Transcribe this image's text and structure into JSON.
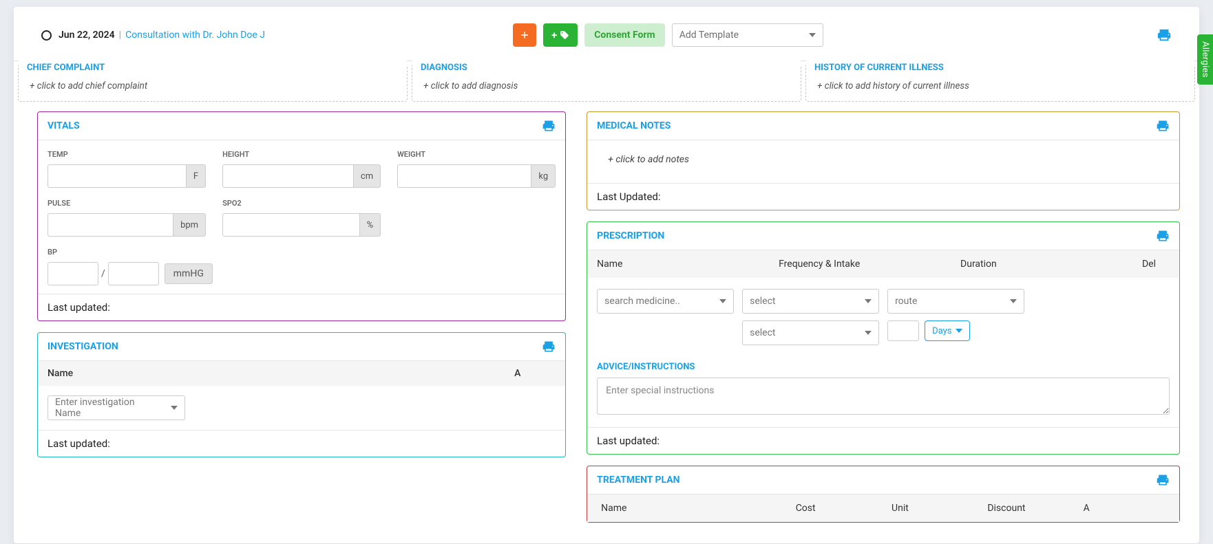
{
  "header": {
    "date": "Jun 22, 2024",
    "consultation_label": "Consultation with Dr. John Doe J",
    "consent_label": "Consent Form",
    "template_placeholder": "Add Template",
    "allergies_tab": "Allergies"
  },
  "complaint_boxes": {
    "chief_complaint": {
      "title": "CHIEF COMPLAINT",
      "hint": "+ click to add chief complaint"
    },
    "diagnosis": {
      "title": "DIAGNOSIS",
      "hint": "+ click to add diagnosis"
    },
    "history": {
      "title": "HISTORY OF CURRENT ILLNESS",
      "hint": "+ click to add history of current illness"
    }
  },
  "vitals": {
    "title": "VITALS",
    "fields": {
      "temp": {
        "label": "TEMP",
        "unit": "F"
      },
      "height": {
        "label": "HEIGHT",
        "unit": "cm"
      },
      "weight": {
        "label": "WEIGHT",
        "unit": "kg"
      },
      "pulse": {
        "label": "PULSE",
        "unit": "bpm"
      },
      "spo2": {
        "label": "SPO2",
        "unit": "%"
      },
      "bp": {
        "label": "BP",
        "unit": "mmHG"
      }
    },
    "last_updated_label": "Last updated:"
  },
  "investigation": {
    "title": "INVESTIGATION",
    "col_name": "Name",
    "col_a": "A",
    "placeholder": "Enter investigation Name",
    "last_updated_label": "Last updated:"
  },
  "medical_notes": {
    "title": "MEDICAL NOTES",
    "hint": "+ click to add notes",
    "last_updated_label": "Last Updated:"
  },
  "prescription": {
    "title": "PRESCRIPTION",
    "columns": {
      "name": "Name",
      "freq": "Frequency & Intake",
      "duration": "Duration",
      "del": "Del"
    },
    "medicine_placeholder": "search medicine..",
    "select_placeholder": "select",
    "route_placeholder": "route",
    "days_label": "Days",
    "advice_label": "ADVICE/INSTRUCTIONS",
    "advice_placeholder": "Enter special instructions",
    "last_updated_label": "Last updated:"
  },
  "treatment": {
    "title": "TREATMENT PLAN",
    "columns": {
      "name": "Name",
      "cost": "Cost",
      "unit": "Unit",
      "discount": "Discount",
      "a": "A"
    }
  }
}
